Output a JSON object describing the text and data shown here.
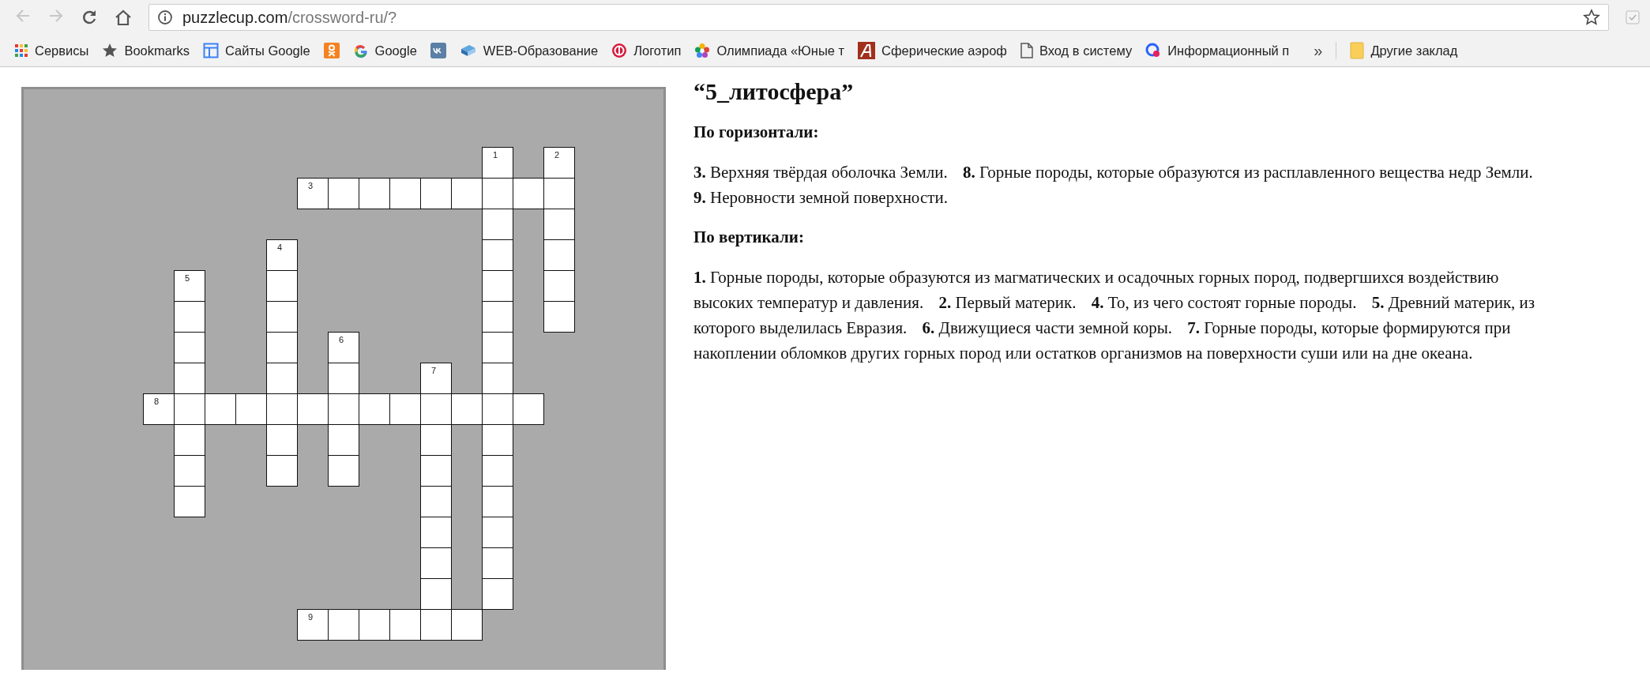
{
  "browser": {
    "back": {
      "disabled": true
    },
    "forward": {
      "disabled": true
    },
    "url_host": "puzzlecup.com",
    "url_path": "/crossword-ru/?",
    "bookmarks": [
      {
        "kind": "apps",
        "label": "Сервисы"
      },
      {
        "kind": "star",
        "label": "Bookmarks"
      },
      {
        "kind": "sites",
        "label": "Сайты Google"
      },
      {
        "kind": "ok"
      },
      {
        "kind": "google",
        "label": "Google"
      },
      {
        "kind": "vk"
      },
      {
        "kind": "book",
        "label": "WEB-Образование"
      },
      {
        "kind": "logo",
        "label": "Логотип"
      },
      {
        "kind": "flower",
        "label": "Олимпиада «Юные т"
      },
      {
        "kind": "letter",
        "label": "Сферические аэроф"
      },
      {
        "kind": "page",
        "label": "Вход в систему"
      },
      {
        "kind": "circle",
        "label": "Информационный п"
      }
    ],
    "overflow": "»",
    "other_bookmarks": "Другие заклад"
  },
  "crossword": {
    "rows": [
      [
        {
          "kind": "block"
        },
        {
          "kind": "block"
        },
        {
          "kind": "block"
        },
        {
          "kind": "block"
        },
        {
          "kind": "block"
        },
        {
          "kind": "block"
        },
        {
          "kind": "block"
        },
        {
          "kind": "block"
        },
        {
          "kind": "block"
        },
        {
          "kind": "block"
        },
        {
          "kind": "block"
        },
        {
          "kind": "letter",
          "number": "1"
        },
        {
          "kind": "block"
        },
        {
          "kind": "letter",
          "number": "2"
        }
      ],
      [
        {
          "kind": "block"
        },
        {
          "kind": "block"
        },
        {
          "kind": "block"
        },
        {
          "kind": "block"
        },
        {
          "kind": "block"
        },
        {
          "kind": "letter",
          "number": "3"
        },
        {
          "kind": "letter"
        },
        {
          "kind": "letter"
        },
        {
          "kind": "letter"
        },
        {
          "kind": "letter"
        },
        {
          "kind": "letter"
        },
        {
          "kind": "letter"
        },
        {
          "kind": "letter"
        },
        {
          "kind": "letter"
        }
      ],
      [
        {
          "kind": "block"
        },
        {
          "kind": "block"
        },
        {
          "kind": "block"
        },
        {
          "kind": "block"
        },
        {
          "kind": "block"
        },
        {
          "kind": "block"
        },
        {
          "kind": "block"
        },
        {
          "kind": "block"
        },
        {
          "kind": "block"
        },
        {
          "kind": "block"
        },
        {
          "kind": "block"
        },
        {
          "kind": "letter"
        },
        {
          "kind": "block"
        },
        {
          "kind": "letter"
        }
      ],
      [
        {
          "kind": "block"
        },
        {
          "kind": "block"
        },
        {
          "kind": "block"
        },
        {
          "kind": "block"
        },
        {
          "kind": "letter",
          "number": "4"
        },
        {
          "kind": "block"
        },
        {
          "kind": "block"
        },
        {
          "kind": "block"
        },
        {
          "kind": "block"
        },
        {
          "kind": "block"
        },
        {
          "kind": "block"
        },
        {
          "kind": "letter"
        },
        {
          "kind": "block"
        },
        {
          "kind": "letter"
        }
      ],
      [
        {
          "kind": "block"
        },
        {
          "kind": "letter",
          "number": "5"
        },
        {
          "kind": "block"
        },
        {
          "kind": "block"
        },
        {
          "kind": "letter"
        },
        {
          "kind": "block"
        },
        {
          "kind": "block"
        },
        {
          "kind": "block"
        },
        {
          "kind": "block"
        },
        {
          "kind": "block"
        },
        {
          "kind": "block"
        },
        {
          "kind": "letter"
        },
        {
          "kind": "block"
        },
        {
          "kind": "letter"
        }
      ],
      [
        {
          "kind": "block"
        },
        {
          "kind": "letter"
        },
        {
          "kind": "block"
        },
        {
          "kind": "block"
        },
        {
          "kind": "letter"
        },
        {
          "kind": "block"
        },
        {
          "kind": "block"
        },
        {
          "kind": "block"
        },
        {
          "kind": "block"
        },
        {
          "kind": "block"
        },
        {
          "kind": "block"
        },
        {
          "kind": "letter"
        },
        {
          "kind": "block"
        },
        {
          "kind": "letter"
        }
      ],
      [
        {
          "kind": "block"
        },
        {
          "kind": "letter"
        },
        {
          "kind": "block"
        },
        {
          "kind": "block"
        },
        {
          "kind": "letter"
        },
        {
          "kind": "block"
        },
        {
          "kind": "letter",
          "number": "6"
        },
        {
          "kind": "block"
        },
        {
          "kind": "block"
        },
        {
          "kind": "block"
        },
        {
          "kind": "block"
        },
        {
          "kind": "letter"
        },
        {
          "kind": "block"
        },
        {
          "kind": "block"
        }
      ],
      [
        {
          "kind": "block"
        },
        {
          "kind": "letter"
        },
        {
          "kind": "block"
        },
        {
          "kind": "block"
        },
        {
          "kind": "letter"
        },
        {
          "kind": "block"
        },
        {
          "kind": "letter"
        },
        {
          "kind": "block"
        },
        {
          "kind": "block"
        },
        {
          "kind": "letter",
          "number": "7"
        },
        {
          "kind": "block"
        },
        {
          "kind": "letter"
        },
        {
          "kind": "block"
        },
        {
          "kind": "block"
        }
      ],
      [
        {
          "kind": "letter",
          "number": "8"
        },
        {
          "kind": "letter"
        },
        {
          "kind": "letter"
        },
        {
          "kind": "letter"
        },
        {
          "kind": "letter"
        },
        {
          "kind": "letter"
        },
        {
          "kind": "letter"
        },
        {
          "kind": "letter"
        },
        {
          "kind": "letter"
        },
        {
          "kind": "letter"
        },
        {
          "kind": "letter"
        },
        {
          "kind": "letter"
        },
        {
          "kind": "letter"
        },
        {
          "kind": "block"
        }
      ],
      [
        {
          "kind": "block"
        },
        {
          "kind": "letter"
        },
        {
          "kind": "block"
        },
        {
          "kind": "block"
        },
        {
          "kind": "letter"
        },
        {
          "kind": "block"
        },
        {
          "kind": "letter"
        },
        {
          "kind": "block"
        },
        {
          "kind": "block"
        },
        {
          "kind": "letter"
        },
        {
          "kind": "block"
        },
        {
          "kind": "letter"
        },
        {
          "kind": "block"
        },
        {
          "kind": "block"
        }
      ],
      [
        {
          "kind": "block"
        },
        {
          "kind": "letter"
        },
        {
          "kind": "block"
        },
        {
          "kind": "block"
        },
        {
          "kind": "letter"
        },
        {
          "kind": "block"
        },
        {
          "kind": "letter"
        },
        {
          "kind": "block"
        },
        {
          "kind": "block"
        },
        {
          "kind": "letter"
        },
        {
          "kind": "block"
        },
        {
          "kind": "letter"
        },
        {
          "kind": "block"
        },
        {
          "kind": "block"
        }
      ],
      [
        {
          "kind": "block"
        },
        {
          "kind": "letter"
        },
        {
          "kind": "block"
        },
        {
          "kind": "block"
        },
        {
          "kind": "block"
        },
        {
          "kind": "block"
        },
        {
          "kind": "block"
        },
        {
          "kind": "block"
        },
        {
          "kind": "block"
        },
        {
          "kind": "letter"
        },
        {
          "kind": "block"
        },
        {
          "kind": "letter"
        },
        {
          "kind": "block"
        },
        {
          "kind": "block"
        }
      ],
      [
        {
          "kind": "block"
        },
        {
          "kind": "block"
        },
        {
          "kind": "block"
        },
        {
          "kind": "block"
        },
        {
          "kind": "block"
        },
        {
          "kind": "block"
        },
        {
          "kind": "block"
        },
        {
          "kind": "block"
        },
        {
          "kind": "block"
        },
        {
          "kind": "letter"
        },
        {
          "kind": "block"
        },
        {
          "kind": "letter"
        },
        {
          "kind": "block"
        },
        {
          "kind": "block"
        }
      ],
      [
        {
          "kind": "block"
        },
        {
          "kind": "block"
        },
        {
          "kind": "block"
        },
        {
          "kind": "block"
        },
        {
          "kind": "block"
        },
        {
          "kind": "block"
        },
        {
          "kind": "block"
        },
        {
          "kind": "block"
        },
        {
          "kind": "block"
        },
        {
          "kind": "letter"
        },
        {
          "kind": "block"
        },
        {
          "kind": "letter"
        },
        {
          "kind": "block"
        },
        {
          "kind": "block"
        }
      ],
      [
        {
          "kind": "block"
        },
        {
          "kind": "block"
        },
        {
          "kind": "block"
        },
        {
          "kind": "block"
        },
        {
          "kind": "block"
        },
        {
          "kind": "block"
        },
        {
          "kind": "block"
        },
        {
          "kind": "block"
        },
        {
          "kind": "block"
        },
        {
          "kind": "letter"
        },
        {
          "kind": "block"
        },
        {
          "kind": "letter"
        },
        {
          "kind": "block"
        },
        {
          "kind": "block"
        }
      ],
      [
        {
          "kind": "block"
        },
        {
          "kind": "block"
        },
        {
          "kind": "block"
        },
        {
          "kind": "block"
        },
        {
          "kind": "block"
        },
        {
          "kind": "letter",
          "number": "9"
        },
        {
          "kind": "letter"
        },
        {
          "kind": "letter"
        },
        {
          "kind": "letter"
        },
        {
          "kind": "letter"
        },
        {
          "kind": "letter"
        },
        {
          "kind": "block"
        },
        {
          "kind": "block"
        },
        {
          "kind": "block"
        }
      ]
    ]
  },
  "clues": {
    "title": "“5_литосфера”",
    "sections": [
      {
        "heading": "По горизонтали:",
        "items": [
          {
            "number": "3.",
            "text": "Верхняя твёрдая оболочка Земли."
          },
          {
            "number": "8.",
            "text": "Горные породы, которые образуются из расплавленного вещества недр Земли."
          },
          {
            "number": "9.",
            "text": "Неровности земной поверхности."
          }
        ]
      },
      {
        "heading": "По вертикали:",
        "items": [
          {
            "number": "1.",
            "text": "Горные породы, которые образуются из магматических и осадочных горных пород, подвергшихся воздействию высоких температур и давления."
          },
          {
            "number": "2.",
            "text": "Первый материк."
          },
          {
            "number": "4.",
            "text": "То, из чего состоят горные породы."
          },
          {
            "number": "5.",
            "text": "Древний материк, из которого выделилась Евразия."
          },
          {
            "number": "6.",
            "text": "Движущиеся части земной коры."
          },
          {
            "number": "7.",
            "text": "Горные породы, которые формируются при накоплении обломков других горных пород или остатков организмов на поверхности суши или на дне океана."
          }
        ]
      }
    ]
  }
}
